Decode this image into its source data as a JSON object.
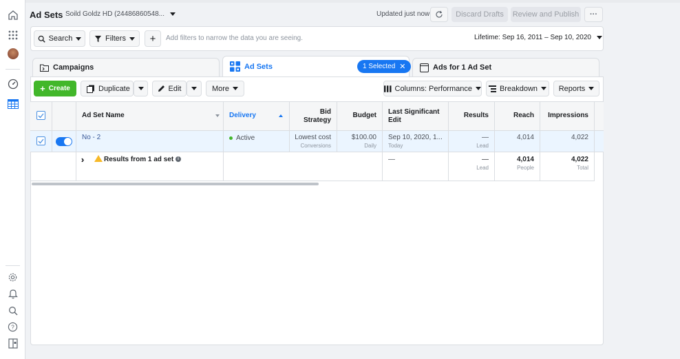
{
  "header": {
    "title": "Ad Sets",
    "account": "Soild Goldz HD (24486860548...",
    "updated": "Updated just now",
    "discard_drafts": "Discard Drafts",
    "review_publish": "Review and Publish",
    "more_dots": "···"
  },
  "filterbar": {
    "search": "Search",
    "filters": "Filters",
    "add": "+",
    "placeholder": "Add filters to narrow the data you are seeing.",
    "lifetime": "Lifetime: Sep 16, 2011 – Sep 10, 2020"
  },
  "tabs": {
    "campaigns": "Campaigns",
    "ad_sets": "Ad Sets",
    "selected_pill": "1 Selected",
    "ads": "Ads for 1 Ad Set"
  },
  "toolbar": {
    "create": "Create",
    "duplicate": "Duplicate",
    "edit": "Edit",
    "more": "More",
    "columns": "Columns: Performance",
    "breakdown": "Breakdown",
    "reports": "Reports"
  },
  "table": {
    "headers": {
      "name": "Ad Set Name",
      "delivery": "Delivery",
      "bid1": "Bid",
      "bid2": "Strategy",
      "budget": "Budget",
      "last1": "Last Significant",
      "last2": "Edit",
      "results": "Results",
      "reach": "Reach",
      "impressions": "Impressions"
    },
    "row": {
      "name": "No - 2",
      "delivery": "Active",
      "bid": "Lowest cost",
      "bid_sub": "Conversions",
      "budget": "$100.00",
      "budget_sub": "Daily",
      "last": "Sep 10, 2020, 1...",
      "last_sub": "Today",
      "results": "—",
      "results_sub": "Lead",
      "reach": "4,014",
      "impressions": "4,022"
    },
    "summary": {
      "label": "Results from 1 ad set",
      "last": "—",
      "results": "—",
      "results_sub": "Lead",
      "reach": "4,014",
      "reach_sub": "People",
      "impressions": "4,022",
      "impressions_sub": "Total"
    }
  },
  "colors": {
    "accent": "#1877f2",
    "create_green": "#42b72a",
    "warning": "#f7b928"
  }
}
